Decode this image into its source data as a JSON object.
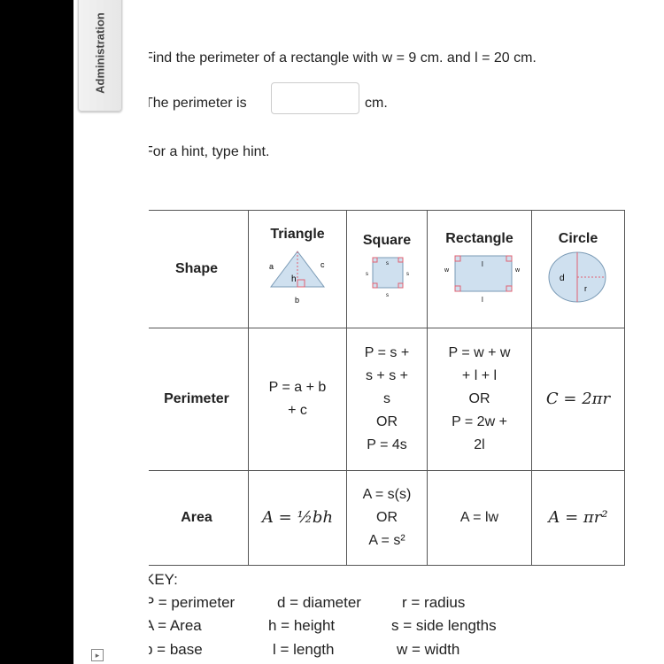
{
  "tab": {
    "label": "Administration"
  },
  "question": {
    "prompt": "Find the perimeter of a rectangle with w = 9 cm. and l = 20 cm.",
    "answer_prefix": "The perimeter is",
    "answer_value": "",
    "answer_unit": "cm.",
    "hint": "For a hint, type hint."
  },
  "table": {
    "headers": {
      "row_label": "Shape",
      "triangle": "Triangle",
      "square": "Square",
      "rectangle": "Rectangle",
      "circle": "Circle"
    },
    "diagram_labels": {
      "tri_a": "a",
      "tri_c": "c",
      "tri_h": "h",
      "tri_b": "b",
      "sq_s": "s",
      "rect_w": "w",
      "rect_l": "l",
      "circ_d": "d",
      "circ_r": "r"
    },
    "perimeter": {
      "label": "Perimeter",
      "triangle": [
        "P = a + b",
        "+ c"
      ],
      "square": [
        "P = s +",
        "s + s +",
        "s",
        "OR",
        "P = 4s"
      ],
      "rectangle": [
        "P = w + w",
        "+ l + l",
        "OR",
        "P = 2w +",
        "2l"
      ],
      "circle": "C = 2πr"
    },
    "area": {
      "label": "Area",
      "triangle": "A = ½bh",
      "square": [
        "A = s(s)",
        "OR",
        "A = s²"
      ],
      "rectangle": "A = lw",
      "circle": "A = πr²"
    }
  },
  "key": {
    "title": "KEY:",
    "items": [
      [
        "P = perimeter",
        "d = diameter",
        "r = radius"
      ],
      [
        "A = Area",
        "h = height",
        "s = side lengths"
      ],
      [
        "b = base",
        "l = length",
        "w = width"
      ]
    ]
  },
  "colors": {
    "shape_fill": "#cfe0ef",
    "right_angle": "#e06070"
  },
  "icons": {
    "expand": "expand-icon"
  }
}
